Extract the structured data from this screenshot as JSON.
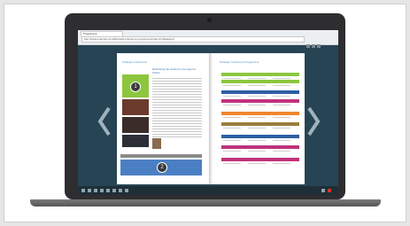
{
  "browser": {
    "tab_title": "Programme",
    "url": "http://www.example.com/flipbook/conference-programme/index.html#page=2"
  },
  "left_page": {
    "header": "Strategic Conference",
    "headline": "Rethinking the Outlook in the Age for Online",
    "marker_1": "1",
    "marker_2": "2"
  },
  "right_page": {
    "header": "Strategic Conference Programme"
  },
  "colors": {
    "screen_bg": "#274454",
    "green": "#8cc63f",
    "blue_bar": "#4b7fc4",
    "schedule": [
      "#8cc63f",
      "#2d5fa3",
      "#c0327a",
      "#f0862f",
      "#9a7d3d",
      "#2d5fa3",
      "#c0327a"
    ]
  },
  "icons": [
    "prev-page-icon",
    "next-page-icon"
  ]
}
